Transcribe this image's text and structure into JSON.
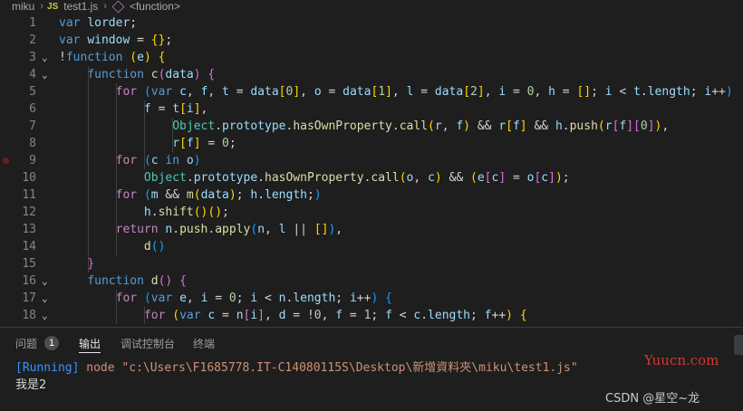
{
  "breadcrumb": {
    "folder": "miku",
    "file_badge": "JS",
    "file": "test1.js",
    "symbol": "<function>"
  },
  "lines": [
    {
      "n": "1",
      "t": [
        [
          "kw",
          "var"
        ],
        [
          "op",
          " "
        ],
        [
          "id",
          "lorder"
        ],
        [
          "op",
          ";"
        ]
      ]
    },
    {
      "n": "2",
      "t": [
        [
          "kw",
          "var"
        ],
        [
          "op",
          " "
        ],
        [
          "id",
          "window"
        ],
        [
          "op",
          " = "
        ],
        [
          "b1",
          "{}"
        ],
        [
          "op",
          ";"
        ]
      ]
    },
    {
      "n": "3",
      "fold": true,
      "t": [
        [
          "op",
          "!"
        ],
        [
          "kw",
          "function"
        ],
        [
          "op",
          " "
        ],
        [
          "b1",
          "("
        ],
        [
          "id",
          "e"
        ],
        [
          "b1",
          ")"
        ],
        [
          "op",
          " "
        ],
        [
          "b1",
          "{"
        ]
      ]
    },
    {
      "n": "4",
      "fold": true,
      "t": [
        [
          "op",
          "    "
        ],
        [
          "kw",
          "function"
        ],
        [
          "op",
          " "
        ],
        [
          "fn",
          "c"
        ],
        [
          "b2",
          "("
        ],
        [
          "id",
          "data"
        ],
        [
          "b2",
          ")"
        ],
        [
          "op",
          " "
        ],
        [
          "b2",
          "{"
        ]
      ]
    },
    {
      "n": "5",
      "t": [
        [
          "op",
          "        "
        ],
        [
          "kc",
          "for"
        ],
        [
          "op",
          " "
        ],
        [
          "b3",
          "("
        ],
        [
          "kw",
          "var"
        ],
        [
          "op",
          " "
        ],
        [
          "id",
          "c"
        ],
        [
          "op",
          ", "
        ],
        [
          "id",
          "f"
        ],
        [
          "op",
          ", "
        ],
        [
          "id",
          "t"
        ],
        [
          "op",
          " = "
        ],
        [
          "id",
          "data"
        ],
        [
          "b1",
          "["
        ],
        [
          "num",
          "0"
        ],
        [
          "b1",
          "]"
        ],
        [
          "op",
          ", "
        ],
        [
          "id",
          "o"
        ],
        [
          "op",
          " = "
        ],
        [
          "id",
          "data"
        ],
        [
          "b1",
          "["
        ],
        [
          "num",
          "1"
        ],
        [
          "b1",
          "]"
        ],
        [
          "op",
          ", "
        ],
        [
          "id",
          "l"
        ],
        [
          "op",
          " = "
        ],
        [
          "id",
          "data"
        ],
        [
          "b1",
          "["
        ],
        [
          "num",
          "2"
        ],
        [
          "b1",
          "]"
        ],
        [
          "op",
          ", "
        ],
        [
          "id",
          "i"
        ],
        [
          "op",
          " = "
        ],
        [
          "num",
          "0"
        ],
        [
          "op",
          ", "
        ],
        [
          "id",
          "h"
        ],
        [
          "op",
          " = "
        ],
        [
          "b1",
          "[]"
        ],
        [
          "op",
          "; "
        ],
        [
          "id",
          "i"
        ],
        [
          "op",
          " < "
        ],
        [
          "id",
          "t"
        ],
        [
          "op",
          "."
        ],
        [
          "id",
          "length"
        ],
        [
          "op",
          "; "
        ],
        [
          "id",
          "i"
        ],
        [
          "op",
          "++"
        ],
        [
          "b3",
          ")"
        ]
      ]
    },
    {
      "n": "6",
      "t": [
        [
          "op",
          "            "
        ],
        [
          "id",
          "f"
        ],
        [
          "op",
          " = "
        ],
        [
          "id",
          "t"
        ],
        [
          "b1",
          "["
        ],
        [
          "id",
          "i"
        ],
        [
          "b1",
          "]"
        ],
        [
          "op",
          ","
        ]
      ]
    },
    {
      "n": "7",
      "t": [
        [
          "op",
          "                "
        ],
        [
          "cls",
          "Object"
        ],
        [
          "op",
          "."
        ],
        [
          "id",
          "prototype"
        ],
        [
          "op",
          "."
        ],
        [
          "fn",
          "hasOwnProperty"
        ],
        [
          "op",
          "."
        ],
        [
          "fn",
          "call"
        ],
        [
          "b1",
          "("
        ],
        [
          "id",
          "r"
        ],
        [
          "op",
          ", "
        ],
        [
          "id",
          "f"
        ],
        [
          "b1",
          ")"
        ],
        [
          "op",
          " && "
        ],
        [
          "id",
          "r"
        ],
        [
          "b1",
          "["
        ],
        [
          "id",
          "f"
        ],
        [
          "b1",
          "]"
        ],
        [
          "op",
          " && "
        ],
        [
          "id",
          "h"
        ],
        [
          "op",
          "."
        ],
        [
          "fn",
          "push"
        ],
        [
          "b1",
          "("
        ],
        [
          "id",
          "r"
        ],
        [
          "b2",
          "["
        ],
        [
          "id",
          "f"
        ],
        [
          "b2",
          "]"
        ],
        [
          "b2",
          "["
        ],
        [
          "num",
          "0"
        ],
        [
          "b2",
          "]"
        ],
        [
          "b1",
          ")"
        ],
        [
          "op",
          ","
        ]
      ]
    },
    {
      "n": "8",
      "t": [
        [
          "op",
          "                "
        ],
        [
          "id",
          "r"
        ],
        [
          "b1",
          "["
        ],
        [
          "id",
          "f"
        ],
        [
          "b1",
          "]"
        ],
        [
          "op",
          " = "
        ],
        [
          "num",
          "0"
        ],
        [
          "op",
          ";"
        ]
      ]
    },
    {
      "n": "9",
      "bp": true,
      "t": [
        [
          "op",
          "        "
        ],
        [
          "kc",
          "for"
        ],
        [
          "op",
          " "
        ],
        [
          "b3",
          "("
        ],
        [
          "id",
          "c"
        ],
        [
          "op",
          " "
        ],
        [
          "kw",
          "in"
        ],
        [
          "op",
          " "
        ],
        [
          "id",
          "o"
        ],
        [
          "b3",
          ")"
        ]
      ]
    },
    {
      "n": "10",
      "t": [
        [
          "op",
          "            "
        ],
        [
          "cls",
          "Object"
        ],
        [
          "op",
          "."
        ],
        [
          "id",
          "prototype"
        ],
        [
          "op",
          "."
        ],
        [
          "fn",
          "hasOwnProperty"
        ],
        [
          "op",
          "."
        ],
        [
          "fn",
          "call"
        ],
        [
          "b1",
          "("
        ],
        [
          "id",
          "o"
        ],
        [
          "op",
          ", "
        ],
        [
          "id",
          "c"
        ],
        [
          "b1",
          ")"
        ],
        [
          "op",
          " && "
        ],
        [
          "b1",
          "("
        ],
        [
          "id",
          "e"
        ],
        [
          "b2",
          "["
        ],
        [
          "id",
          "c"
        ],
        [
          "b2",
          "]"
        ],
        [
          "op",
          " = "
        ],
        [
          "id",
          "o"
        ],
        [
          "b2",
          "["
        ],
        [
          "id",
          "c"
        ],
        [
          "b2",
          "]"
        ],
        [
          "b1",
          ")"
        ],
        [
          "op",
          ";"
        ]
      ]
    },
    {
      "n": "11",
      "t": [
        [
          "op",
          "        "
        ],
        [
          "kc",
          "for"
        ],
        [
          "op",
          " "
        ],
        [
          "b3",
          "("
        ],
        [
          "id",
          "m"
        ],
        [
          "op",
          " && "
        ],
        [
          "fn",
          "m"
        ],
        [
          "b1",
          "("
        ],
        [
          "id",
          "data"
        ],
        [
          "b1",
          ")"
        ],
        [
          "op",
          "; "
        ],
        [
          "id",
          "h"
        ],
        [
          "op",
          "."
        ],
        [
          "id",
          "length"
        ],
        [
          "op",
          ";"
        ],
        [
          "b3",
          ")"
        ]
      ]
    },
    {
      "n": "12",
      "t": [
        [
          "op",
          "            "
        ],
        [
          "id",
          "h"
        ],
        [
          "op",
          "."
        ],
        [
          "fn",
          "shift"
        ],
        [
          "b1",
          "()"
        ],
        [
          "b1",
          "()"
        ],
        [
          "op",
          ";"
        ]
      ]
    },
    {
      "n": "13",
      "t": [
        [
          "op",
          "        "
        ],
        [
          "kc",
          "return"
        ],
        [
          "op",
          " "
        ],
        [
          "id",
          "n"
        ],
        [
          "op",
          "."
        ],
        [
          "fn",
          "push"
        ],
        [
          "op",
          "."
        ],
        [
          "fn",
          "apply"
        ],
        [
          "b3",
          "("
        ],
        [
          "id",
          "n"
        ],
        [
          "op",
          ", "
        ],
        [
          "id",
          "l"
        ],
        [
          "op",
          " || "
        ],
        [
          "b1",
          "[]"
        ],
        [
          "b3",
          ")"
        ],
        [
          "op",
          ","
        ]
      ]
    },
    {
      "n": "14",
      "t": [
        [
          "op",
          "            "
        ],
        [
          "fn",
          "d"
        ],
        [
          "b3",
          "()"
        ]
      ]
    },
    {
      "n": "15",
      "t": [
        [
          "op",
          "    "
        ],
        [
          "b2",
          "}"
        ]
      ]
    },
    {
      "n": "16",
      "fold": true,
      "t": [
        [
          "op",
          "    "
        ],
        [
          "kw",
          "function"
        ],
        [
          "op",
          " "
        ],
        [
          "fn",
          "d"
        ],
        [
          "b2",
          "()"
        ],
        [
          "op",
          " "
        ],
        [
          "b2",
          "{"
        ]
      ]
    },
    {
      "n": "17",
      "fold": true,
      "t": [
        [
          "op",
          "        "
        ],
        [
          "kc",
          "for"
        ],
        [
          "op",
          " "
        ],
        [
          "b3",
          "("
        ],
        [
          "kw",
          "var"
        ],
        [
          "op",
          " "
        ],
        [
          "id",
          "e"
        ],
        [
          "op",
          ", "
        ],
        [
          "id",
          "i"
        ],
        [
          "op",
          " = "
        ],
        [
          "num",
          "0"
        ],
        [
          "op",
          "; "
        ],
        [
          "id",
          "i"
        ],
        [
          "op",
          " < "
        ],
        [
          "id",
          "n"
        ],
        [
          "op",
          "."
        ],
        [
          "id",
          "length"
        ],
        [
          "op",
          "; "
        ],
        [
          "id",
          "i"
        ],
        [
          "op",
          "++"
        ],
        [
          "b3",
          ")"
        ],
        [
          "op",
          " "
        ],
        [
          "b3",
          "{"
        ]
      ]
    },
    {
      "n": "18",
      "fold": true,
      "t": [
        [
          "op",
          "            "
        ],
        [
          "kc",
          "for"
        ],
        [
          "op",
          " "
        ],
        [
          "b1",
          "("
        ],
        [
          "kw",
          "var"
        ],
        [
          "op",
          " "
        ],
        [
          "id",
          "c"
        ],
        [
          "op",
          " = "
        ],
        [
          "id",
          "n"
        ],
        [
          "b2",
          "["
        ],
        [
          "id",
          "i"
        ],
        [
          "b2",
          "]"
        ],
        [
          "op",
          ", "
        ],
        [
          "id",
          "d"
        ],
        [
          "op",
          " = "
        ],
        [
          "op",
          "!"
        ],
        [
          "num",
          "0"
        ],
        [
          "op",
          ", "
        ],
        [
          "id",
          "f"
        ],
        [
          "op",
          " = "
        ],
        [
          "num",
          "1"
        ],
        [
          "op",
          "; "
        ],
        [
          "id",
          "f"
        ],
        [
          "op",
          " < "
        ],
        [
          "id",
          "c"
        ],
        [
          "op",
          "."
        ],
        [
          "id",
          "length"
        ],
        [
          "op",
          "; "
        ],
        [
          "id",
          "f"
        ],
        [
          "op",
          "++"
        ],
        [
          "b1",
          ")"
        ],
        [
          "op",
          " "
        ],
        [
          "b1",
          "{"
        ]
      ]
    }
  ],
  "panel": {
    "tabs": [
      {
        "label": "问题",
        "badge": "1"
      },
      {
        "label": "输出"
      },
      {
        "label": "调试控制台"
      },
      {
        "label": "终端"
      }
    ],
    "output_running": "[Running]",
    "output_command": " node \"c:\\Users\\F1685778.IT-C14080115S\\Desktop\\新增資料夾\\miku\\test1.js\"",
    "output_result": "我是2"
  },
  "watermarks": {
    "site": "Yuucn.com",
    "author": "CSDN @星空~龙"
  }
}
